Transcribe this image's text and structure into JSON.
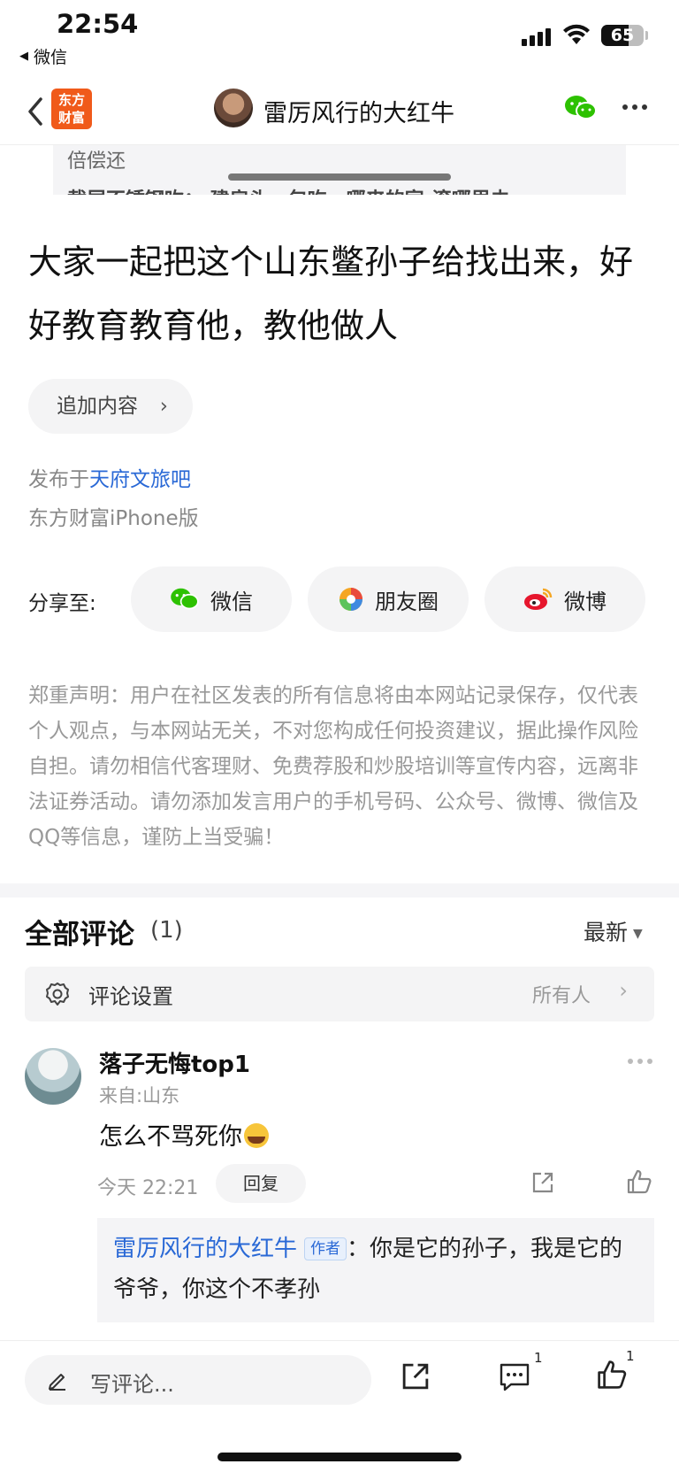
{
  "status_bar": {
    "time": "22:54",
    "back_app": "微信",
    "battery": "65",
    "battery_level": 0.65
  },
  "nav": {
    "logo_line1": "东方",
    "logo_line2": "财富",
    "title": "雷厉风行的大红牛",
    "icons": [
      "back-chevron-icon",
      "wechat-icon",
      "more-icon"
    ]
  },
  "quote_clip": {
    "line1": "倍偿还",
    "line2": "截屏不锈钢吹：  建房头，包吃，哪来的家-滚哪里去"
  },
  "post": {
    "headline": "大家一起把这个山东鳖孙子给找出来，好好教育教育他，教他做人",
    "append_label": "追加内容",
    "published_prefix": "发布于",
    "published_forum": "天府文旅吧",
    "device": "东方财富iPhone版"
  },
  "share": {
    "label": "分享至:",
    "targets": [
      {
        "label": "微信",
        "icon": "wechat-icon",
        "color": "#2dc100"
      },
      {
        "label": "朋友圈",
        "icon": "moments-icon",
        "color": "#f5a623"
      },
      {
        "label": "微博",
        "icon": "weibo-icon",
        "color": "#e6162d"
      }
    ]
  },
  "disclaimer": "郑重声明：用户在社区发表的所有信息将由本网站记录保存，仅代表个人观点，与本网站无关，不对您构成任何投资建议，据此操作风险自担。请勿相信代客理财、免费荐股和炒股培训等宣传内容，远离非法证券活动。请勿添加发言用户的手机号码、公众号、微博、微信及QQ等信息，谨防上当受骗！",
  "comments_section": {
    "title": "全部评论",
    "count": "(1)",
    "sort": "最新",
    "settings_label": "评论设置",
    "settings_value": "所有人"
  },
  "comments": [
    {
      "name": "落子无悔top1",
      "location": "来自:山东",
      "text": "怎么不骂死你",
      "time": "今天 22:21",
      "reply_label": "回复",
      "reply": {
        "author": "雷厉风行的大红牛",
        "tag": "作者",
        "text": "：你是它的孙子，我是它的爷爷，你这个不孝孙"
      }
    }
  ],
  "bottom_bar": {
    "placeholder": "写评论...",
    "comment_count": "1",
    "like_count": "1"
  },
  "colors": {
    "accent_blue": "#2a69d6",
    "brand_orange": "#f05a1a"
  }
}
